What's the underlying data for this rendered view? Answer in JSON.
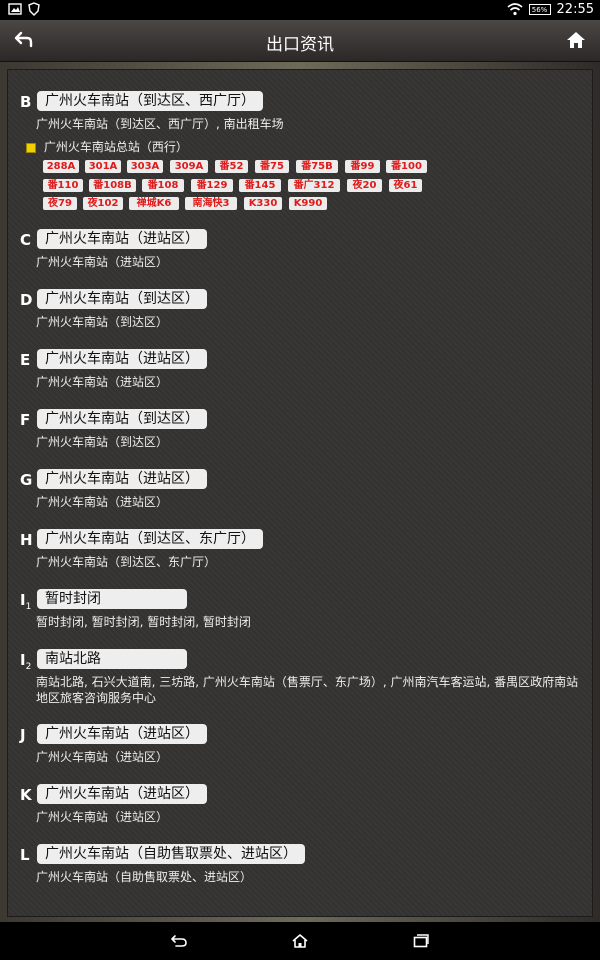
{
  "status_bar": {
    "battery": "56%",
    "time": "22:55"
  },
  "header": {
    "title": "出口资讯"
  },
  "exits": [
    {
      "letter": "B",
      "name": "广州火车南站（到达区、西广厅）",
      "desc": "广州火车南站（到达区、西广厅）, 南出租车场"
    },
    {
      "letter": "C",
      "name": "广州火车南站（进站区）",
      "desc": "广州火车南站（进站区）"
    },
    {
      "letter": "D",
      "name": "广州火车南站（到达区）",
      "desc": "广州火车南站（到达区）"
    },
    {
      "letter": "E",
      "name": "广州火车南站（进站区）",
      "desc": "广州火车南站（进站区）"
    },
    {
      "letter": "F",
      "name": "广州火车南站（到达区）",
      "desc": "广州火车南站（到达区）"
    },
    {
      "letter": "G",
      "name": "广州火车南站（进站区）",
      "desc": "广州火车南站（进站区）"
    },
    {
      "letter": "H",
      "name": "广州火车南站（到达区、东广厅）",
      "desc": "广州火车南站（到达区、东广厅）"
    },
    {
      "letter": "I",
      "sub": "1",
      "name": "暂时封闭",
      "desc": "暂时封闭, 暂时封闭, 暂时封闭, 暂时封闭"
    },
    {
      "letter": "I",
      "sub": "2",
      "name": "南站北路",
      "desc": "南站北路, 石兴大道南, 三坊路, 广州火车南站（售票厅、东广场）, 广州南汽车客运站, 番禺区政府南站地区旅客咨询服务中心"
    },
    {
      "letter": "J",
      "name": "广州火车南站（进站区）",
      "desc": "广州火车南站（进站区）"
    },
    {
      "letter": "K",
      "name": "广州火车南站（进站区）",
      "desc": "广州火车南站（进站区）"
    },
    {
      "letter": "L",
      "name": "广州火车南站（自助售取票处、进站区）",
      "desc": "广州火车南站（自助售取票处、进站区）"
    }
  ],
  "bus_stop": {
    "name": "广州火车南站总站（西行）",
    "routes": [
      "288A",
      "301A",
      "303A",
      "309A",
      "番52",
      "番75",
      "番75B",
      "番99",
      "番100",
      "番110",
      "番108B",
      "番108",
      "番129",
      "番145",
      "番广312",
      "夜20",
      "夜61",
      "夜79",
      "夜102",
      "禅城K6",
      "南海快3",
      "K330",
      "K990"
    ]
  }
}
